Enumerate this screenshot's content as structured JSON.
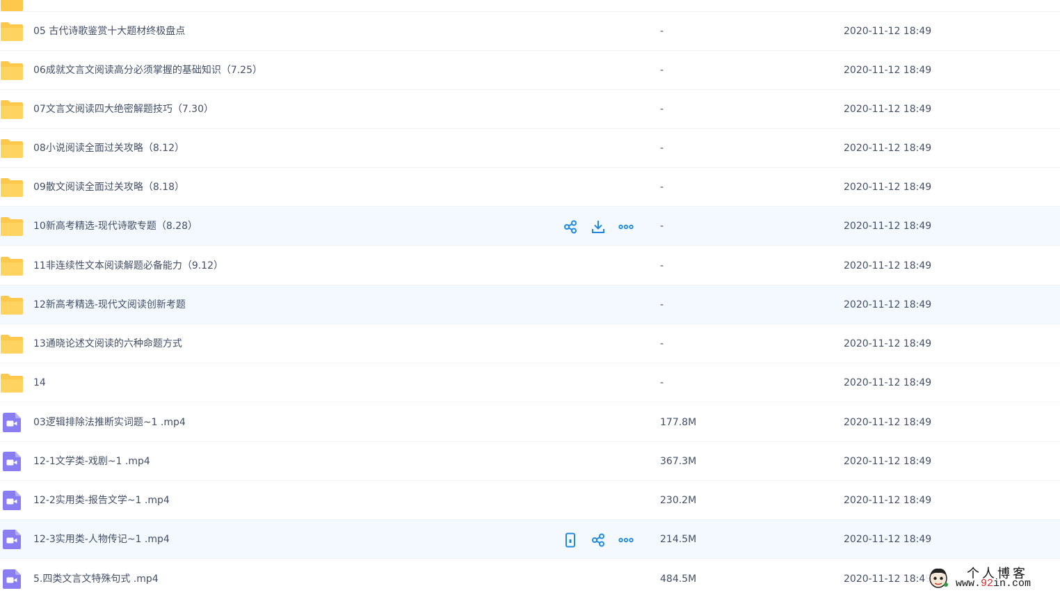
{
  "colors": {
    "folder": "#fdc84b",
    "video": "#8a7cf1",
    "action_icon": "#1e89e0",
    "row_highlight": "#f4f9ff",
    "text": "#424e67"
  },
  "rows": [
    {
      "type": "folder",
      "name": "05 古代诗歌鉴赏十大题材终极盘点",
      "size": "-",
      "time": "2020-11-12 18:49"
    },
    {
      "type": "folder",
      "name": "06成就文言文阅读高分必须掌握的基础知识（7.25）",
      "size": "-",
      "time": "2020-11-12 18:49"
    },
    {
      "type": "folder",
      "name": "07文言文阅读四大绝密解题技巧（7.30）",
      "size": "-",
      "time": "2020-11-12 18:49"
    },
    {
      "type": "folder",
      "name": "08小说阅读全面过关攻略（8.12）",
      "size": "-",
      "time": "2020-11-12 18:49"
    },
    {
      "type": "folder",
      "name": "09散文阅读全面过关攻略（8.18）",
      "size": "-",
      "time": "2020-11-12 18:49"
    },
    {
      "type": "folder",
      "name": "10新高考精选-现代诗歌专题（8.28）",
      "size": "-",
      "time": "2020-11-12 18:49"
    },
    {
      "type": "folder",
      "name": "11非连续性文本阅读解题必备能力（9.12）",
      "size": "-",
      "time": "2020-11-12 18:49"
    },
    {
      "type": "folder",
      "name": "12新高考精选-现代文阅读创新考题",
      "size": "-",
      "time": "2020-11-12 18:49"
    },
    {
      "type": "folder",
      "name": "13通晓论述文阅读的六种命题方式",
      "size": "-",
      "time": "2020-11-12 18:49"
    },
    {
      "type": "folder",
      "name": "14",
      "size": "-",
      "time": "2020-11-12 18:49"
    },
    {
      "type": "video",
      "name": "03逻辑排除法推断实词题~1 .mp4",
      "size": "177.8M",
      "time": "2020-11-12 18:49"
    },
    {
      "type": "video",
      "name": "12-1文学类-戏剧~1 .mp4",
      "size": "367.3M",
      "time": "2020-11-12 18:49"
    },
    {
      "type": "video",
      "name": "12-2实用类-报告文学~1 .mp4",
      "size": "230.2M",
      "time": "2020-11-12 18:49"
    },
    {
      "type": "video",
      "name": "12-3实用类-人物传记~1 .mp4",
      "size": "214.5M",
      "time": "2020-11-12 18:49"
    },
    {
      "type": "video",
      "name": "5.四类文言文特殊句式 .mp4",
      "size": "484.5M",
      "time": "2020-11-12 18:49"
    }
  ],
  "hover_actions": {
    "folder": [
      "share-icon",
      "download-icon",
      "more-icon"
    ],
    "video": [
      "phone-icon",
      "share-icon",
      "more-icon"
    ]
  },
  "watermark": {
    "title": "个人博客",
    "url_prefix": "www.",
    "url_number": "92",
    "url_suffix": "in.com"
  }
}
